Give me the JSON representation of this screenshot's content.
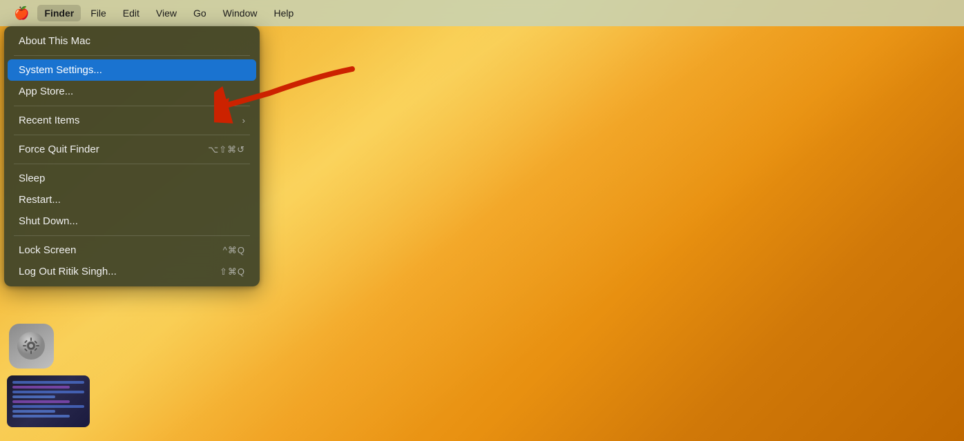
{
  "desktop": {
    "background": "orange-gradient"
  },
  "menubar": {
    "apple_icon": "🍎",
    "items": [
      {
        "label": "Finder",
        "bold": true
      },
      {
        "label": "File"
      },
      {
        "label": "Edit"
      },
      {
        "label": "View"
      },
      {
        "label": "Go"
      },
      {
        "label": "Window"
      },
      {
        "label": "Help"
      }
    ]
  },
  "apple_menu": {
    "items": [
      {
        "id": "about",
        "label": "About This Mac",
        "shortcut": "",
        "separator_after": true
      },
      {
        "id": "system-settings",
        "label": "System Settings...",
        "shortcut": "",
        "highlighted": true,
        "separator_after": false
      },
      {
        "id": "app-store",
        "label": "App Store...",
        "shortcut": "",
        "separator_after": true
      },
      {
        "id": "recent-items",
        "label": "Recent Items",
        "chevron": "›",
        "separator_after": false
      },
      {
        "id": "force-quit",
        "label": "Force Quit Finder",
        "shortcut": "⌥⇧⌘↺",
        "separator_after": true
      },
      {
        "id": "sleep",
        "label": "Sleep",
        "shortcut": "",
        "separator_after": false
      },
      {
        "id": "restart",
        "label": "Restart...",
        "shortcut": "",
        "separator_after": false
      },
      {
        "id": "shutdown",
        "label": "Shut Down...",
        "shortcut": "",
        "separator_after": true
      },
      {
        "id": "lock-screen",
        "label": "Lock Screen",
        "shortcut": "^⌘Q",
        "separator_after": false
      },
      {
        "id": "logout",
        "label": "Log Out Ritik Singh...",
        "shortcut": "⇧⌘Q",
        "separator_after": false
      }
    ]
  },
  "annotation": {
    "arrow_color": "#cc0000"
  }
}
